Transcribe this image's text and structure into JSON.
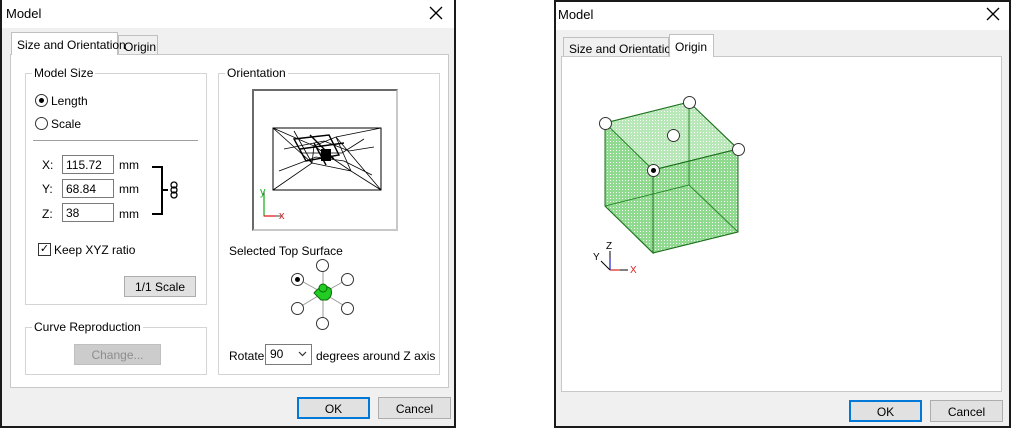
{
  "left_dialog": {
    "title": "Model",
    "tabs": [
      {
        "label": "Size and Orientation",
        "active": true
      },
      {
        "label": "Origin",
        "active": false
      }
    ],
    "model_size": {
      "label": "Model Size",
      "options": [
        {
          "label": "Length",
          "selected": true
        },
        {
          "label": "Scale",
          "selected": false
        }
      ],
      "fields": [
        {
          "axis": "X:",
          "value": "115.72",
          "unit": "mm"
        },
        {
          "axis": "Y:",
          "value": "68.84",
          "unit": "mm"
        },
        {
          "axis": "Z:",
          "value": "38",
          "unit": "mm"
        }
      ],
      "keep_ratio": {
        "label": "Keep XYZ ratio",
        "checked": true
      },
      "scale_button": "1/1 Scale"
    },
    "curve_reproduction": {
      "label": "Curve Reproduction",
      "change_button": "Change..."
    },
    "orientation": {
      "label": "Orientation",
      "axis_y": "y",
      "axis_x": "x",
      "selected_top_surface_label": "Selected Top Surface",
      "rotate_label": "Rotate",
      "rotate_value": "90",
      "rotate_suffix": "degrees around Z axis"
    },
    "ok": "OK",
    "cancel": "Cancel"
  },
  "right_dialog": {
    "title": "Model",
    "tabs": [
      {
        "label": "Size and Orientation",
        "active": false
      },
      {
        "label": "Origin",
        "active": true
      }
    ],
    "axes": {
      "z": "Z",
      "y": "Y",
      "x": "X"
    },
    "ok": "OK",
    "cancel": "Cancel"
  },
  "colors": {
    "accent": "#0078d7",
    "box_fill": "#7fd27f",
    "box_edge": "#2a8a2a",
    "axis_x": "#e02020",
    "axis_y": "#20b020",
    "surface_marker": "#22cc22"
  }
}
